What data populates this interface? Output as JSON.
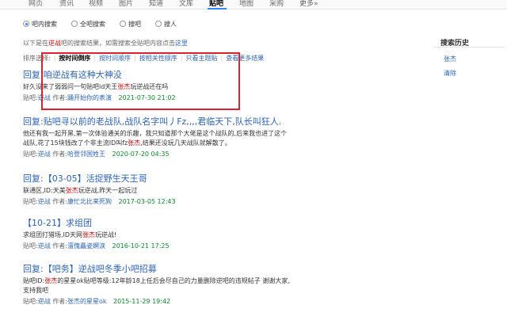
{
  "top_nav": {
    "items": [
      "网页",
      "资讯",
      "视频",
      "图片",
      "知道",
      "文库",
      "贴吧",
      "地图",
      "采购",
      "更多»"
    ],
    "active_index": 6
  },
  "scope": {
    "options": [
      "吧内搜索",
      "全吧搜索",
      "搜吧",
      "搜人"
    ],
    "selected_index": 0
  },
  "note": {
    "prefix": "以下是在",
    "keyword": "逆战",
    "middle": "吧的搜索结果，如需搜索全贴吧内容点击",
    "link": "这里"
  },
  "sort": {
    "label": "排序选择:",
    "current": "按时间倒序",
    "options": [
      "按时间顺序",
      "按相关性顺序",
      "只看主题贴",
      "查看更多结果"
    ]
  },
  "results": [
    {
      "title_pre": "回复:",
      "title_kw": "",
      "title_post": "咱逆战有这种大神没",
      "abs_pre": "好久没来了弱弱问一句贴吧id天王",
      "abs_kw": "张杰",
      "abs_post": "玩逆战还在吗",
      "bar_label": "贴吧:",
      "bar": "逆战",
      "author_label": "作者:",
      "author": "踊开始你的表演",
      "date": "2021-07-30 21:02"
    },
    {
      "title_pre": "回复:贴吧寻以前的老战队,战队名字叫丿Fz,,,,君临天下,队长叫狂人.",
      "title_kw": "",
      "title_post": "",
      "abs_pre": "他还有我一起开黑,第一次体验通关的乐趣，我只知道那个大佬是这个战队的,后来我也进了这个战队,花了15块钱改了个非主流ID叫fz",
      "abs_kw": "张杰",
      "abs_post": ",结果还没玩几天战队就解散了。",
      "bar_label": "贴吧:",
      "bar": "逆战",
      "author_label": "作者:",
      "author": "哈登邻国姓王",
      "date": "2020-07-20 04:35"
    },
    {
      "title_pre": "回复:【03-05】活捉野生天王哥",
      "title_kw": "",
      "title_post": "",
      "abs_pre": "联通区,ID:天美",
      "abs_kw": "张杰",
      "abs_post": "玩逆战,昨天一起玩过",
      "bar_label": "贴吧:",
      "bar": "逆战",
      "author_label": "作者:",
      "author": "康忙北比来死狗",
      "date": "2017-03-05 12:43"
    },
    {
      "title_pre": "【10-21】求组团",
      "title_kw": "",
      "title_post": "",
      "abs_pre": "求组团打猎场,ID天网",
      "abs_kw": "张杰",
      "abs_post": "玩逆战!",
      "bar_label": "贴吧:",
      "bar": "逆战",
      "author_label": "作者:",
      "author": "澶傀矗姿婀涙",
      "date": "2016-10-21 17:25"
    },
    {
      "title_pre": "回复:【吧务】逆战吧冬季小吧招募",
      "title_kw": "",
      "title_post": "",
      "abs_pre": "贴吧ID:",
      "abs_kw": "张杰",
      "abs_post": "的星星ok贴吧等级:12年龄18上任后会尽自己的力量删除逆吧的违规帖子 谢谢大家,支持我吧",
      "bar_label": "贴吧:",
      "bar": "逆战",
      "author_label": "作者:",
      "author": "张杰的星星ok",
      "date": "2015-11-29 19:42"
    }
  ],
  "sidebar": {
    "heading": "搜索历史",
    "history_item": "张杰",
    "clear_label": "清除"
  },
  "colors": {
    "link": "#2d64b3",
    "keyword": "#cc0000",
    "date": "#0a8a2a",
    "highlight_box": "#d9232e"
  }
}
